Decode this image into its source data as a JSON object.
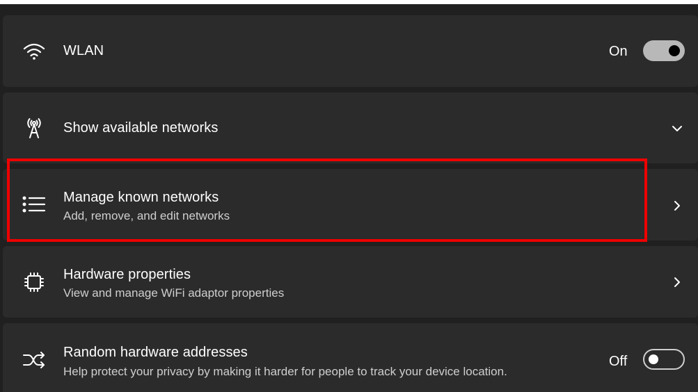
{
  "settings": {
    "wlan": {
      "title": "WLAN",
      "state": "On",
      "icon": "wifi-icon"
    },
    "available": {
      "title": "Show available networks",
      "icon": "antenna-icon"
    },
    "known": {
      "title": "Manage known networks",
      "subtitle": "Add, remove, and edit networks",
      "icon": "list-icon"
    },
    "hardware": {
      "title": "Hardware properties",
      "subtitle": "View and manage WiFi adaptor properties",
      "icon": "chip-icon"
    },
    "random": {
      "title": "Random hardware addresses",
      "subtitle": "Help protect your privacy by making it harder for people to track your device location.",
      "state": "Off",
      "icon": "shuffle-icon"
    }
  },
  "colors": {
    "background": "#202020",
    "card": "#2b2b2b",
    "highlight": "#ee0000"
  }
}
